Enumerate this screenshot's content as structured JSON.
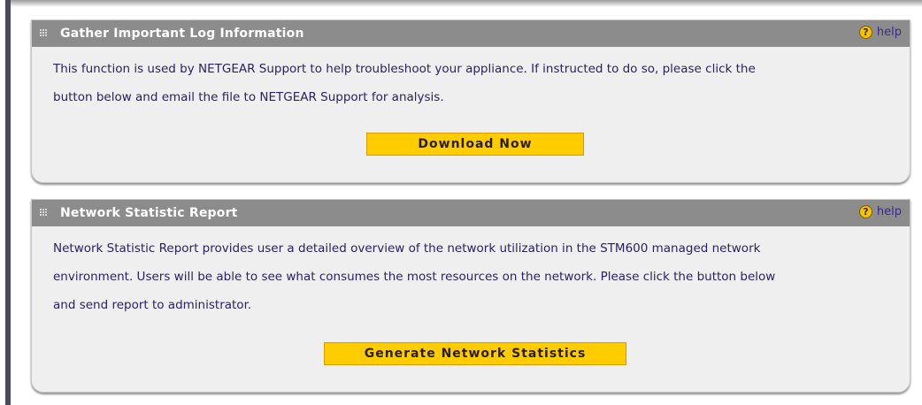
{
  "log_panel": {
    "title": "Gather Important Log Information",
    "help_label": "help",
    "help_glyph": "?",
    "description_line1": "This function is used by NETGEAR Support to help troubleshoot your appliance. If instructed to do so, please click the",
    "description_line2": "button below and email the file to NETGEAR Support for analysis.",
    "button_label": "Download Now"
  },
  "stats_panel": {
    "title": "Network Statistic Report",
    "help_label": "help",
    "help_glyph": "?",
    "description_line1": "Network Statistic Report provides user a detailed overview of the network utilization in the STM600 managed network",
    "description_line2": "environment. Users will be able to see what consumes the most resources on the network. Please click the button below",
    "description_line3": "and send report to administrator.",
    "button_label": "Generate Network Statistics"
  },
  "colors": {
    "header_bg": "#8c8c8c",
    "panel_bg": "#efefef",
    "button_bg": "#ffcc00",
    "text": "#2a2260",
    "help_icon": "#f5c400"
  },
  "icons": {
    "grip": "grip-icon",
    "help": "help-icon"
  }
}
